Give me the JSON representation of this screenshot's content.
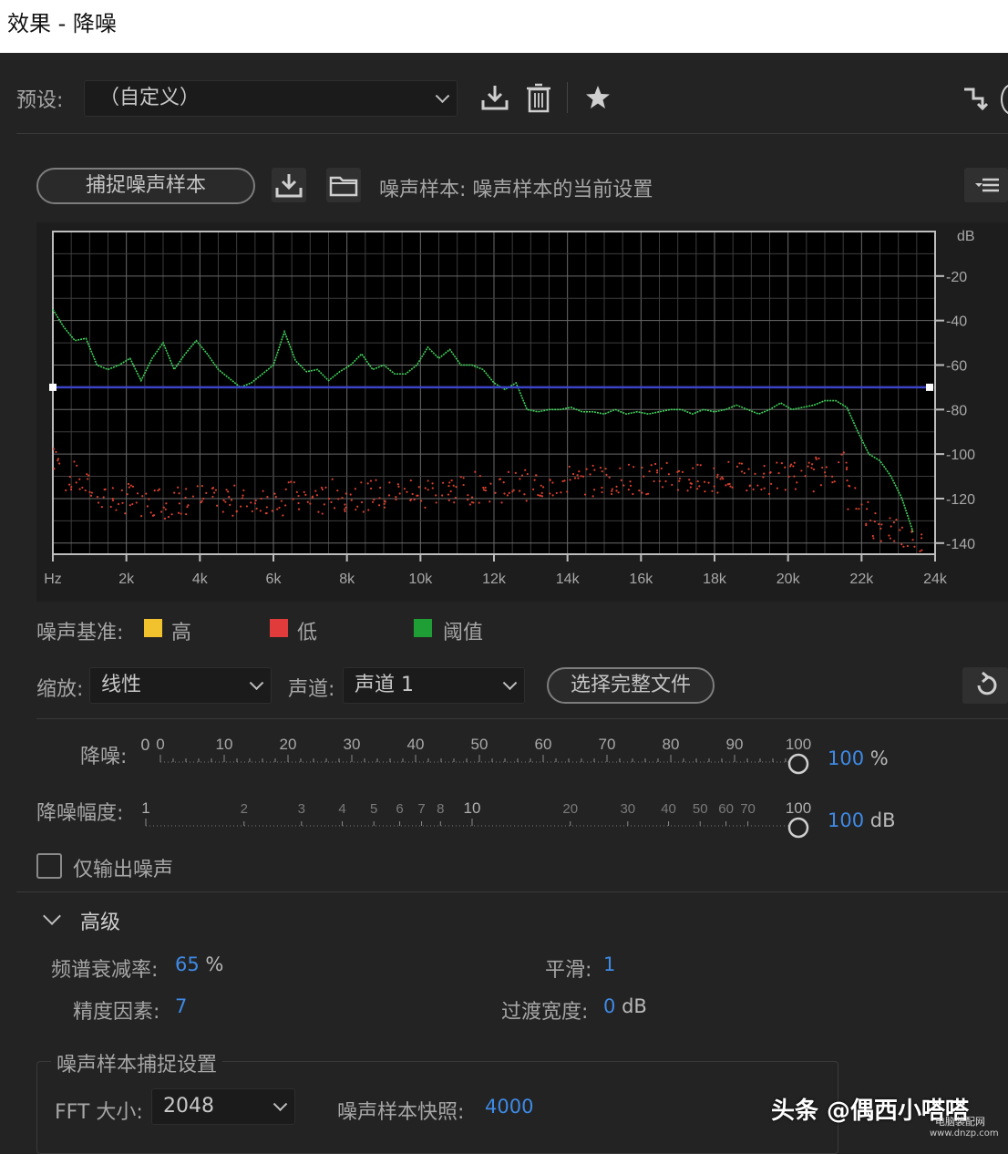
{
  "window": {
    "title": "效果 - 降噪"
  },
  "preset": {
    "label": "预设:",
    "value": "（自定义）"
  },
  "toolbar_icons": [
    "save-preset-icon",
    "delete-preset-icon",
    "favorite-star-icon",
    "routing-icon"
  ],
  "capture": {
    "button_label": "捕捉噪声样本",
    "sample_text": "噪声样本: 噪声样本的当前设置"
  },
  "chart_data": {
    "type": "line",
    "x_unit": "Hz",
    "x_ticks": [
      "Hz",
      "2k",
      "4k",
      "6k",
      "8k",
      "10k",
      "12k",
      "14k",
      "16k",
      "18k",
      "20k",
      "22k",
      "24k"
    ],
    "y_unit": "dB",
    "y_ticks": [
      "-20",
      "-40",
      "-60",
      "-80",
      "-100",
      "-120",
      "-140"
    ],
    "xlim": [
      0,
      24000
    ],
    "ylim": [
      -145,
      0
    ],
    "threshold_db": -70,
    "series": [
      {
        "color": "#3fd25a",
        "x": [
          0,
          300,
          600,
          900,
          1200,
          1500,
          1800,
          2100,
          2400,
          2700,
          3000,
          3300,
          3600,
          3900,
          4200,
          4500,
          4800,
          5100,
          5400,
          5700,
          6000,
          6300,
          6600,
          6900,
          7200,
          7500,
          7800,
          8100,
          8400,
          8700,
          9000,
          9300,
          9600,
          9900,
          10200,
          10500,
          10800,
          11100,
          11400,
          11700,
          12000,
          12300,
          12600,
          12900,
          13200,
          13500,
          13800,
          14100,
          14400,
          14700,
          15000,
          15300,
          15600,
          15900,
          16200,
          16500,
          16800,
          17100,
          17400,
          17700,
          18000,
          18300,
          18600,
          18900,
          19200,
          19500,
          19800,
          20100,
          20400,
          20700,
          21000,
          21300,
          21600,
          21900,
          22200,
          22500,
          22800,
          23100,
          23400
        ],
        "y": [
          -35,
          -43,
          -49,
          -48,
          -60,
          -62,
          -60,
          -57,
          -67,
          -57,
          -50,
          -62,
          -55,
          -49,
          -55,
          -62,
          -66,
          -70,
          -68,
          -64,
          -60,
          -45,
          -58,
          -63,
          -62,
          -67,
          -63,
          -60,
          -55,
          -62,
          -60,
          -64,
          -64,
          -60,
          -52,
          -57,
          -53,
          -60,
          -60,
          -62,
          -68,
          -71,
          -68,
          -80,
          -81,
          -80,
          -80,
          -79,
          -81,
          -81,
          -82,
          -80,
          -82,
          -81,
          -82,
          -81,
          -80,
          -80,
          -82,
          -80,
          -81,
          -80,
          -78,
          -80,
          -82,
          -80,
          -77,
          -80,
          -79,
          -78,
          -76,
          -76,
          -79,
          -90,
          -100,
          -103,
          -110,
          -120,
          -135
        ]
      },
      {
        "color": "#d9402e",
        "x": [
          0,
          300,
          600,
          900,
          1200,
          1500,
          1800,
          2100,
          2400,
          2700,
          3000,
          3300,
          3600,
          3900,
          4200,
          4500,
          4800,
          5100,
          5400,
          5700,
          6000,
          6300,
          6600,
          6900,
          7200,
          7500,
          7800,
          8100,
          8400,
          8700,
          9000,
          9300,
          9600,
          9900,
          10200,
          10500,
          10800,
          11100,
          11400,
          11700,
          12000,
          12300,
          12600,
          12900,
          13200,
          13500,
          13800,
          14100,
          14400,
          14700,
          15000,
          15300,
          15600,
          15900,
          16200,
          16500,
          16800,
          17100,
          17400,
          17700,
          18000,
          18300,
          18600,
          18900,
          19200,
          19500,
          19800,
          20100,
          20400,
          20700,
          21000,
          21300,
          21600,
          21900,
          22200,
          22500,
          22800,
          23100,
          23400
        ],
        "y": [
          -103,
          -110,
          -112,
          -115,
          -118,
          -120,
          -120,
          -121,
          -123,
          -121,
          -122,
          -121,
          -121,
          -120,
          -122,
          -120,
          -121,
          -122,
          -121,
          -120,
          -121,
          -119,
          -120,
          -120,
          -121,
          -118,
          -120,
          -118,
          -119,
          -118,
          -119,
          -118,
          -117,
          -118,
          -116,
          -117,
          -116,
          -117,
          -115,
          -116,
          -115,
          -114,
          -114,
          -113,
          -114,
          -113,
          -112,
          -113,
          -112,
          -112,
          -111,
          -112,
          -111,
          -112,
          -111,
          -110,
          -111,
          -112,
          -111,
          -110,
          -111,
          -110,
          -111,
          -112,
          -111,
          -110,
          -110,
          -109,
          -110,
          -108,
          -106,
          -105,
          -118,
          -128,
          -131,
          -133,
          -135,
          -138,
          -140
        ]
      }
    ]
  },
  "legend": {
    "label": "噪声基准:",
    "items": [
      {
        "name": "高",
        "color": "#f2c12e"
      },
      {
        "name": "低",
        "color": "#e23b3b"
      },
      {
        "name": "阈值",
        "color": "#1e9e34"
      }
    ]
  },
  "scale": {
    "label": "缩放:",
    "value": "线性"
  },
  "channel": {
    "label": "声道:",
    "value": "声道 1"
  },
  "select_file_label": "选择完整文件",
  "reduction": {
    "label": "降噪:",
    "start": "0",
    "ticks": [
      "0",
      "10",
      "20",
      "30",
      "40",
      "50",
      "60",
      "70",
      "80",
      "90",
      "100"
    ],
    "value": "100",
    "unit": "%"
  },
  "amount": {
    "label": "降噪幅度:",
    "ticks": [
      "1",
      "2",
      "3",
      "4",
      "5",
      "6",
      "7",
      "8",
      "10",
      "20",
      "30",
      "40",
      "50",
      "60",
      "70",
      "100"
    ],
    "value": "100",
    "unit": "dB"
  },
  "output_noise_only": {
    "label": "仅输出噪声",
    "checked": false
  },
  "advanced": {
    "label": "高级",
    "spectral_decay": {
      "label": "频谱衰减率:",
      "value": "65",
      "unit": "%"
    },
    "smoothing": {
      "label": "平滑:",
      "value": "1"
    },
    "precision": {
      "label": "精度因素:",
      "value": "7"
    },
    "transition": {
      "label": "过渡宽度:",
      "value": "0",
      "unit": "dB"
    }
  },
  "capture_settings": {
    "label": "噪声样本捕捉设置",
    "fft_label": "FFT 大小:",
    "fft_value": "2048",
    "snapshot_label": "噪声样本快照:",
    "snapshot_value": "4000"
  },
  "watermark": {
    "text": "头条 @偶西小嗒嗒",
    "site": "电脑装配网",
    "url": "www.dnzp.com"
  }
}
